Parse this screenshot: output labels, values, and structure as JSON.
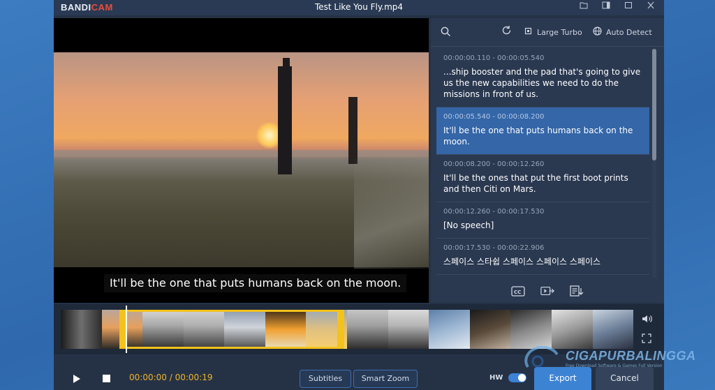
{
  "app": {
    "brand_part1": "BANDI",
    "brand_part2": "CAM",
    "window_title": "Test Like You Fly.mp4"
  },
  "video": {
    "caption": "It'll be the one that puts humans back on the moon."
  },
  "subtitle_panel": {
    "model_label": "Large Turbo",
    "language_label": "Auto Detect",
    "segments": [
      {
        "time": "00:00:00.110 - 00:00:05.540",
        "text": "...ship booster and the pad that's going to give us the new capabilities we need to do the missions in front of us."
      },
      {
        "time": "00:00:05.540 - 00:00:08.200",
        "text": "It'll be the one that puts humans back on the moon."
      },
      {
        "time": "00:00:08.200 - 00:00:12.260",
        "text": "It'll be the ones that put the first boot prints and then Citi on Mars."
      },
      {
        "time": "00:00:12.260 - 00:00:17.530",
        "text": "[No speech]"
      },
      {
        "time": "00:00:17.530 - 00:00:22.906",
        "text": "스페이스 스타쉽 스페이스 스페이스 스페이스"
      }
    ],
    "active_index": 1
  },
  "controls": {
    "current_time": "00:00:00",
    "separator": "/",
    "total_time": "00:00:19",
    "subtitles_label": "Subtitles",
    "smart_zoom_label": "Smart Zoom",
    "hw_label": "HW",
    "export_label": "Export",
    "cancel_label": "Cancel"
  },
  "watermark": {
    "name": "CIGAPURBALINGGA",
    "tagline": "Free Download Software & Games Full Version"
  },
  "colors": {
    "accent": "#3d83d4",
    "active_segment": "#3466a8",
    "selection": "#f3c21c",
    "timecode": "#f0b429"
  }
}
